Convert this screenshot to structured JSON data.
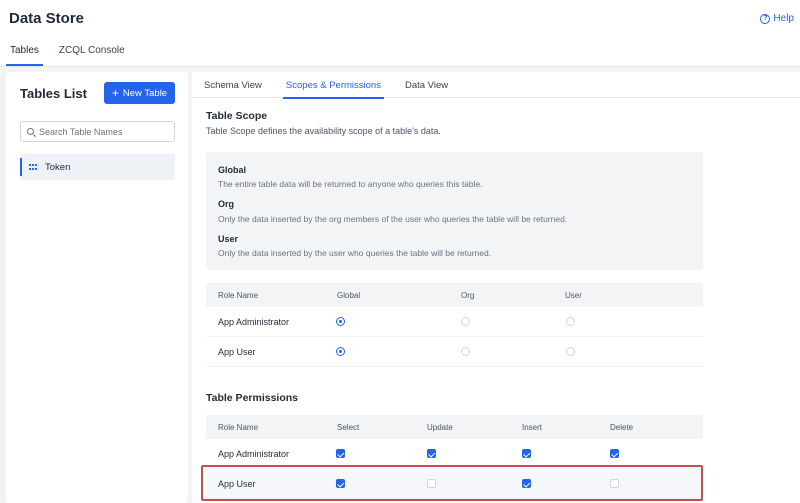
{
  "app": {
    "title": "Data Store",
    "help_label": "Help"
  },
  "top_tabs": [
    {
      "label": "Tables",
      "active": true
    },
    {
      "label": "ZCQL Console",
      "active": false
    }
  ],
  "sidebar": {
    "title": "Tables List",
    "new_table_label": "New Table",
    "search_placeholder": "Search Table Names",
    "tables": [
      {
        "name": "Token",
        "selected": true
      }
    ]
  },
  "sub_tabs": [
    {
      "label": "Schema View",
      "active": false
    },
    {
      "label": "Scopes & Permissions",
      "active": true
    },
    {
      "label": "Data View",
      "active": false
    }
  ],
  "table_scope": {
    "title": "Table Scope",
    "description": "Table Scope defines the availability scope of a table's data.",
    "options": [
      {
        "name": "Global",
        "desc": "The entire table data will be returned to anyone who queries this table."
      },
      {
        "name": "Org",
        "desc": "Only the data inserted by the org members of the user who queries the table will be returned."
      },
      {
        "name": "User",
        "desc": "Only the data inserted by the user who queries the table will be returned."
      }
    ],
    "columns": [
      "Role Name",
      "Global",
      "Org",
      "User"
    ],
    "rows": [
      {
        "role": "App Administrator",
        "selected": "Global"
      },
      {
        "role": "App User",
        "selected": "Global"
      }
    ]
  },
  "table_permissions": {
    "title": "Table Permissions",
    "columns": [
      "Role Name",
      "Select",
      "Update",
      "Insert",
      "Delete"
    ],
    "rows": [
      {
        "role": "App Administrator",
        "select": true,
        "update": true,
        "insert": true,
        "delete": true
      },
      {
        "role": "App User",
        "select": true,
        "update": false,
        "insert": true,
        "delete": false
      }
    ]
  },
  "colors": {
    "accent": "#2563eb",
    "highlight": "#c0504d"
  }
}
